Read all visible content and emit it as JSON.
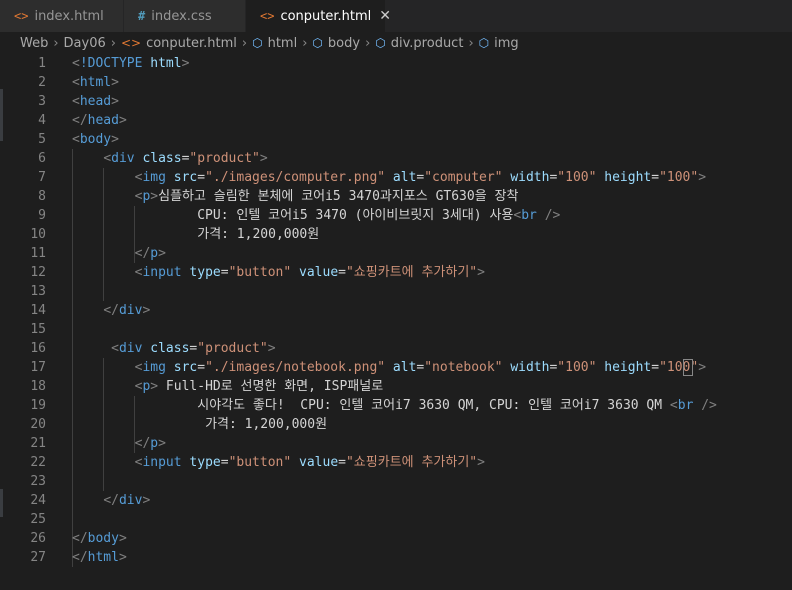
{
  "tabs": [
    {
      "icon": "<>",
      "label": "index.html",
      "active": false
    },
    {
      "icon": "#",
      "label": "index.css",
      "active": false
    },
    {
      "icon": "<>",
      "label": "conputer.html",
      "active": true,
      "close": "✕"
    }
  ],
  "breadcrumb": {
    "items": [
      "Web",
      "Day06",
      "conputer.html",
      "html",
      "body",
      "div.product",
      "img"
    ],
    "separator": "›"
  },
  "lines": [
    {
      "n": "1",
      "tokens": [
        [
          "pun",
          "<"
        ],
        [
          "tag",
          "!DOCTYPE "
        ],
        [
          "att",
          "html"
        ],
        [
          "pun",
          ">"
        ]
      ]
    },
    {
      "n": "2",
      "tokens": [
        [
          "pun",
          "<"
        ],
        [
          "tag",
          "html"
        ],
        [
          "pun",
          ">"
        ]
      ]
    },
    {
      "n": "3",
      "tokens": [
        [
          "pun",
          "<"
        ],
        [
          "tag",
          "head"
        ],
        [
          "pun",
          ">"
        ]
      ]
    },
    {
      "n": "4",
      "tokens": [
        [
          "pun",
          "</"
        ],
        [
          "tag",
          "head"
        ],
        [
          "pun",
          ">"
        ]
      ]
    },
    {
      "n": "5",
      "tokens": [
        [
          "pun",
          "<"
        ],
        [
          "tag",
          "body"
        ],
        [
          "pun",
          ">"
        ]
      ]
    },
    {
      "n": "6",
      "tokens": [
        [
          "txt",
          "    "
        ],
        [
          "pun",
          "<"
        ],
        [
          "tag",
          "div "
        ],
        [
          "att",
          "class"
        ],
        [
          "txt",
          "="
        ],
        [
          "str",
          "\"product\""
        ],
        [
          "pun",
          ">"
        ]
      ]
    },
    {
      "n": "7",
      "tokens": [
        [
          "txt",
          "        "
        ],
        [
          "pun",
          "<"
        ],
        [
          "tag",
          "img "
        ],
        [
          "att",
          "src"
        ],
        [
          "txt",
          "="
        ],
        [
          "str",
          "\"./images/computer.png\" "
        ],
        [
          "att",
          "alt"
        ],
        [
          "txt",
          "="
        ],
        [
          "str",
          "\"computer\" "
        ],
        [
          "att",
          "width"
        ],
        [
          "txt",
          "="
        ],
        [
          "str",
          "\"100\" "
        ],
        [
          "att",
          "height"
        ],
        [
          "txt",
          "="
        ],
        [
          "str",
          "\"100\""
        ],
        [
          "pun",
          ">"
        ]
      ]
    },
    {
      "n": "8",
      "tokens": [
        [
          "txt",
          "        "
        ],
        [
          "pun",
          "<"
        ],
        [
          "tag",
          "p"
        ],
        [
          "pun",
          ">"
        ],
        [
          "txt",
          "심플하고 슬림한 본체에 코어i5 3470과지포스 GT630을 장착"
        ]
      ]
    },
    {
      "n": "9",
      "tokens": [
        [
          "txt",
          "                "
        ],
        [
          "txt",
          "CPU: 인텔 코어i5 3470 (아이비브릿지 3세대) 사용"
        ],
        [
          "pun",
          "<"
        ],
        [
          "tag",
          "br "
        ],
        [
          "pun",
          "/>"
        ]
      ]
    },
    {
      "n": "10",
      "tokens": [
        [
          "txt",
          "                "
        ],
        [
          "txt",
          "가격: 1,200,000원"
        ]
      ]
    },
    {
      "n": "11",
      "tokens": [
        [
          "txt",
          "        "
        ],
        [
          "pun",
          "</"
        ],
        [
          "tag",
          "p"
        ],
        [
          "pun",
          ">"
        ]
      ]
    },
    {
      "n": "12",
      "tokens": [
        [
          "txt",
          "        "
        ],
        [
          "pun",
          "<"
        ],
        [
          "tag",
          "input "
        ],
        [
          "att",
          "type"
        ],
        [
          "txt",
          "="
        ],
        [
          "str",
          "\"button\" "
        ],
        [
          "att",
          "value"
        ],
        [
          "txt",
          "="
        ],
        [
          "str",
          "\"쇼핑카트에 추가하기\""
        ],
        [
          "pun",
          ">"
        ]
      ]
    },
    {
      "n": "13",
      "tokens": []
    },
    {
      "n": "14",
      "tokens": [
        [
          "txt",
          "    "
        ],
        [
          "pun",
          "</"
        ],
        [
          "tag",
          "div"
        ],
        [
          "pun",
          ">"
        ]
      ]
    },
    {
      "n": "15",
      "tokens": []
    },
    {
      "n": "16",
      "tokens": [
        [
          "txt",
          "     "
        ],
        [
          "pun",
          "<"
        ],
        [
          "tag",
          "div "
        ],
        [
          "att",
          "class"
        ],
        [
          "txt",
          "="
        ],
        [
          "str",
          "\"product\""
        ],
        [
          "pun",
          ">"
        ]
      ]
    },
    {
      "n": "17",
      "tokens": [
        [
          "txt",
          "        "
        ],
        [
          "pun",
          "<"
        ],
        [
          "tag",
          "img "
        ],
        [
          "att",
          "src"
        ],
        [
          "txt",
          "="
        ],
        [
          "str",
          "\"./images/notebook.png\" "
        ],
        [
          "att",
          "alt"
        ],
        [
          "txt",
          "="
        ],
        [
          "str",
          "\"notebook\" "
        ],
        [
          "att",
          "width"
        ],
        [
          "txt",
          "="
        ],
        [
          "str",
          "\"100\" "
        ],
        [
          "att",
          "height"
        ],
        [
          "txt",
          "="
        ],
        [
          "str",
          "\"100\""
        ],
        [
          "pun",
          ">"
        ]
      ]
    },
    {
      "n": "18",
      "tokens": [
        [
          "txt",
          "        "
        ],
        [
          "pun",
          "<"
        ],
        [
          "tag",
          "p"
        ],
        [
          "pun",
          ">"
        ],
        [
          "txt",
          " Full-HD로 선명한 화면, ISP패널로"
        ]
      ]
    },
    {
      "n": "19",
      "tokens": [
        [
          "txt",
          "                "
        ],
        [
          "txt",
          "시야각도 좋다!  CPU: 인텔 코어i7 3630 QM, CPU: 인텔 코어i7 3630 QM "
        ],
        [
          "pun",
          "<"
        ],
        [
          "tag",
          "br "
        ],
        [
          "pun",
          "/>"
        ]
      ]
    },
    {
      "n": "20",
      "tokens": [
        [
          "txt",
          "                 "
        ],
        [
          "txt",
          "가격: 1,200,000원"
        ]
      ]
    },
    {
      "n": "21",
      "tokens": [
        [
          "txt",
          "        "
        ],
        [
          "pun",
          "</"
        ],
        [
          "tag",
          "p"
        ],
        [
          "pun",
          ">"
        ]
      ]
    },
    {
      "n": "22",
      "tokens": [
        [
          "txt",
          "        "
        ],
        [
          "pun",
          "<"
        ],
        [
          "tag",
          "input "
        ],
        [
          "att",
          "type"
        ],
        [
          "txt",
          "="
        ],
        [
          "str",
          "\"button\" "
        ],
        [
          "att",
          "value"
        ],
        [
          "txt",
          "="
        ],
        [
          "str",
          "\"쇼핑카트에 추가하기\""
        ],
        [
          "pun",
          ">"
        ]
      ]
    },
    {
      "n": "23",
      "tokens": []
    },
    {
      "n": "24",
      "tokens": [
        [
          "txt",
          "    "
        ],
        [
          "pun",
          "</"
        ],
        [
          "tag",
          "div"
        ],
        [
          "pun",
          ">"
        ]
      ]
    },
    {
      "n": "25",
      "tokens": []
    },
    {
      "n": "26",
      "tokens": [
        [
          "pun",
          "</"
        ],
        [
          "tag",
          "body"
        ],
        [
          "pun",
          ">"
        ]
      ]
    },
    {
      "n": "27",
      "tokens": [
        [
          "pun",
          "</"
        ],
        [
          "tag",
          "html"
        ],
        [
          "pun",
          ">"
        ]
      ]
    }
  ],
  "colors": {
    "background": "#1e1e1e",
    "tag": "#569cd6",
    "attribute": "#9cdcfe",
    "string": "#ce9178",
    "punctuation": "#808080",
    "text": "#d4d4d4",
    "line_number": "#858585"
  }
}
